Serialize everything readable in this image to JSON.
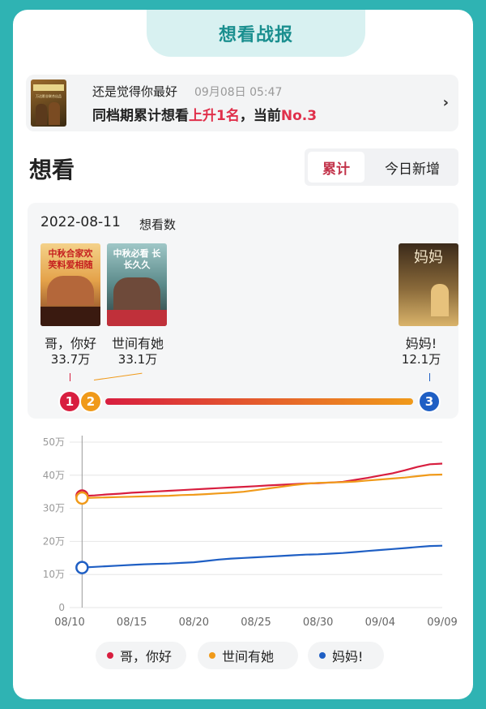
{
  "header": {
    "title": "想看战报"
  },
  "banner": {
    "movie_title": "还是觉得你最好",
    "time": "09月08日 05:47",
    "msg_prefix": "同档期累计想看",
    "msg_highlight": "上升1名",
    "msg_mid": "，当前",
    "msg_rank": "No.3",
    "poster_caption": "万达影业联合出品"
  },
  "section": {
    "title": "想看"
  },
  "segments": {
    "cumulative": "累计",
    "today": "今日新增"
  },
  "ranking": {
    "date": "2022-08-11",
    "metric": "想看数",
    "movies": [
      {
        "rank": "1",
        "name": "哥，你好",
        "value": "33.7万",
        "color": "#d81e3f"
      },
      {
        "rank": "2",
        "name": "世间有她",
        "value": "33.1万",
        "color": "#f09a1a"
      },
      {
        "rank": "3",
        "name": "妈妈!",
        "value": "12.1万",
        "color": "#1f5fc4"
      }
    ],
    "poster_texts": {
      "p1": "中秋合家欢 笑料爱相随",
      "p2": "中秋必看 长长久久",
      "p3": "妈妈"
    }
  },
  "chart_data": {
    "type": "line",
    "x": [
      "08/10",
      "08/11",
      "08/12",
      "08/13",
      "08/14",
      "08/15",
      "08/16",
      "08/17",
      "08/18",
      "08/19",
      "08/20",
      "08/21",
      "08/22",
      "08/23",
      "08/24",
      "08/25",
      "08/26",
      "08/27",
      "08/28",
      "08/29",
      "08/30",
      "08/31",
      "09/01",
      "09/02",
      "09/03",
      "09/04",
      "09/05",
      "09/06",
      "09/07",
      "09/08",
      "09/09"
    ],
    "xticks": [
      "08/10",
      "08/15",
      "08/20",
      "08/25",
      "08/30",
      "09/04",
      "09/09"
    ],
    "yticks": [
      "0",
      "10万",
      "20万",
      "30万",
      "40万",
      "50万"
    ],
    "ylim": [
      0,
      50
    ],
    "series": [
      {
        "name": "哥，你好",
        "color": "#d81e3f",
        "values": [
          null,
          33.7,
          33.9,
          34.2,
          34.4,
          34.7,
          34.9,
          35.1,
          35.3,
          35.5,
          35.7,
          35.9,
          36.1,
          36.3,
          36.5,
          36.7,
          36.9,
          37.1,
          37.3,
          37.5,
          37.6,
          37.8,
          38.0,
          38.6,
          39.2,
          39.9,
          40.6,
          41.5,
          42.5,
          43.3,
          43.5
        ]
      },
      {
        "name": "世间有她",
        "color": "#f09a1a",
        "values": [
          null,
          33.1,
          33.2,
          33.3,
          33.4,
          33.5,
          33.6,
          33.7,
          33.8,
          34.0,
          34.1,
          34.3,
          34.5,
          34.7,
          35.0,
          35.5,
          36.0,
          36.5,
          37.0,
          37.4,
          37.7,
          37.8,
          37.9,
          38.1,
          38.4,
          38.7,
          39.0,
          39.3,
          39.7,
          40.1,
          40.2
        ]
      },
      {
        "name": "妈妈!",
        "color": "#1f5fc4",
        "values": [
          null,
          12.1,
          12.3,
          12.5,
          12.7,
          12.9,
          13.1,
          13.2,
          13.3,
          13.5,
          13.7,
          14.1,
          14.5,
          14.8,
          15.0,
          15.2,
          15.4,
          15.6,
          15.8,
          16.0,
          16.1,
          16.3,
          16.5,
          16.8,
          17.1,
          17.4,
          17.7,
          18.0,
          18.3,
          18.6,
          18.7
        ]
      }
    ],
    "marker_index": 1,
    "legend": [
      "哥，你好",
      "世间有她",
      "妈妈!"
    ]
  }
}
